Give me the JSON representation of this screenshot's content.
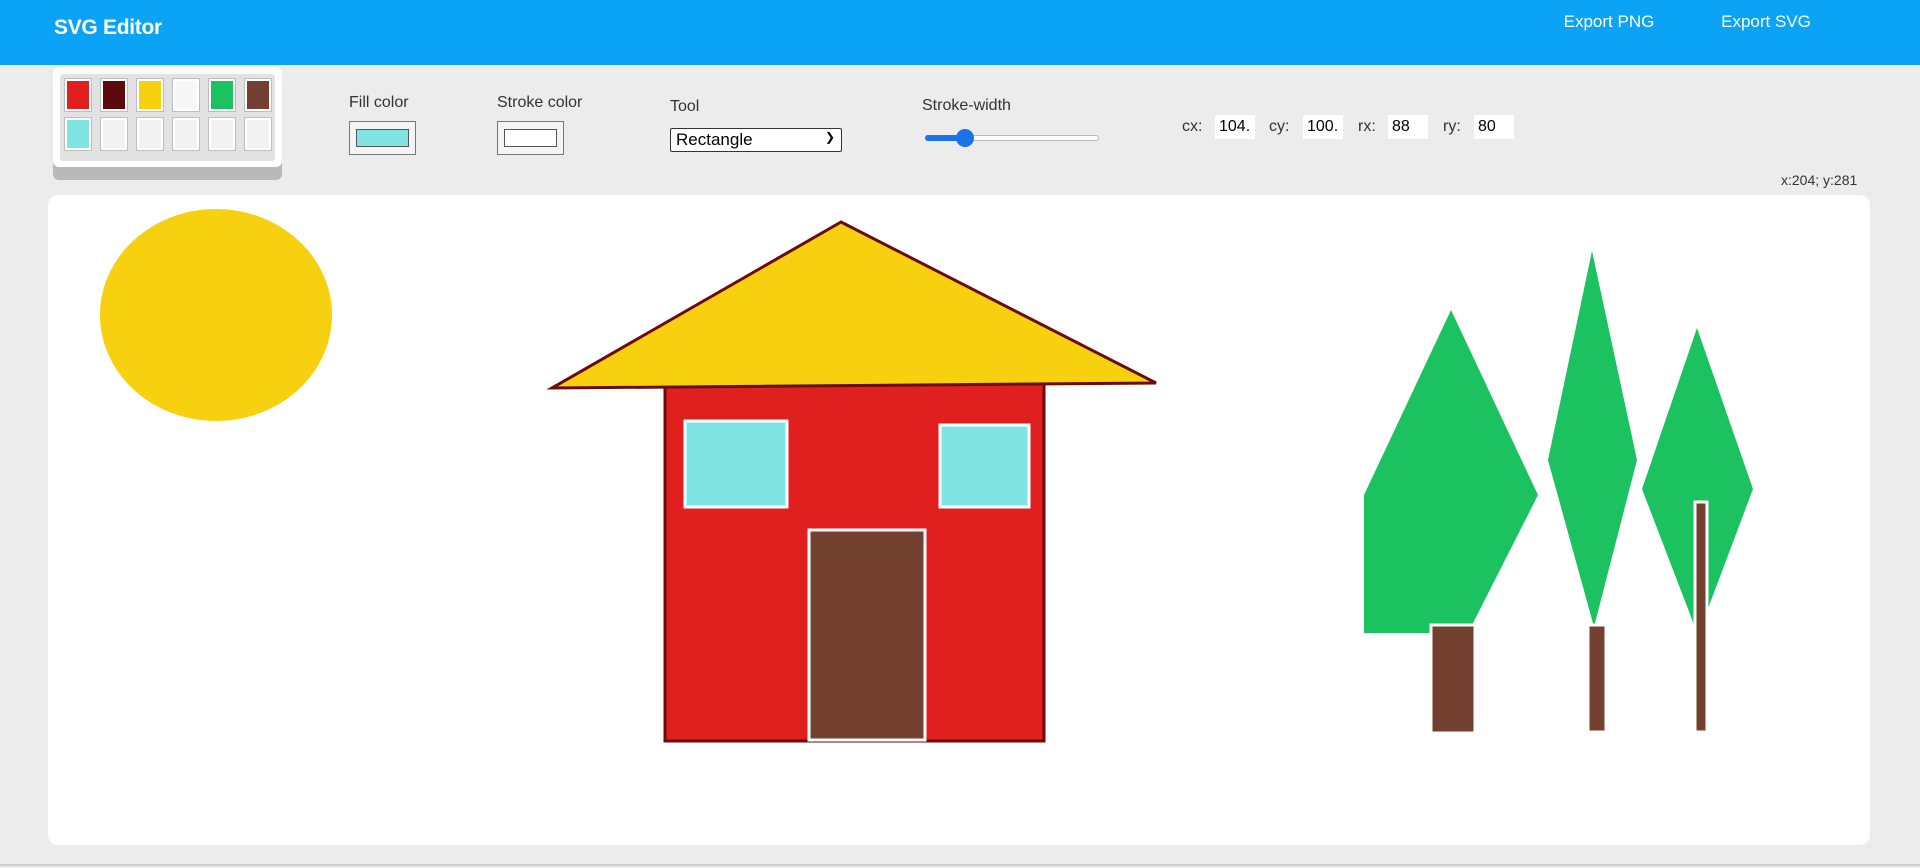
{
  "header": {
    "title": "SVG Editor",
    "export_png": "Export PNG",
    "export_svg": "Export SVG",
    "background": "#0aa3f6"
  },
  "palette": {
    "swatches": [
      "#e01f1f",
      "#5c0a0a",
      "#f7d010",
      "#f7f7f7",
      "#1cc160",
      "#74402f",
      "#7fe4e2",
      "#f2f2f2",
      "#f2f2f2",
      "#f2f2f2",
      "#f2f2f2",
      "#f2f2f2"
    ]
  },
  "controls": {
    "fill_label": "Fill color",
    "fill_value": "#7fe4e2",
    "stroke_label": "Stroke color",
    "stroke_value": "#ffffff",
    "tool_label": "Tool",
    "tool_selected": "Rectangle",
    "stroke_width_label": "Stroke-width",
    "stroke_width_fraction": 0.2
  },
  "shape_params": {
    "cx_label": "cx:",
    "cx": "104.",
    "cy_label": "cy:",
    "cy": "100.",
    "rx_label": "rx:",
    "rx": "88",
    "ry_label": "ry:",
    "ry": "80"
  },
  "status": {
    "coords": "x:204; y:281"
  },
  "drawing_colors": {
    "sun": "#f7d010",
    "roof": "#f7d010",
    "roof_stroke": "#6b0b0b",
    "wall": "#e01f1f",
    "wall_stroke": "#6b0b0b",
    "window": "#7fe4e2",
    "door": "#74402f",
    "foliage": "#1cc160",
    "trunk": "#74402f"
  }
}
